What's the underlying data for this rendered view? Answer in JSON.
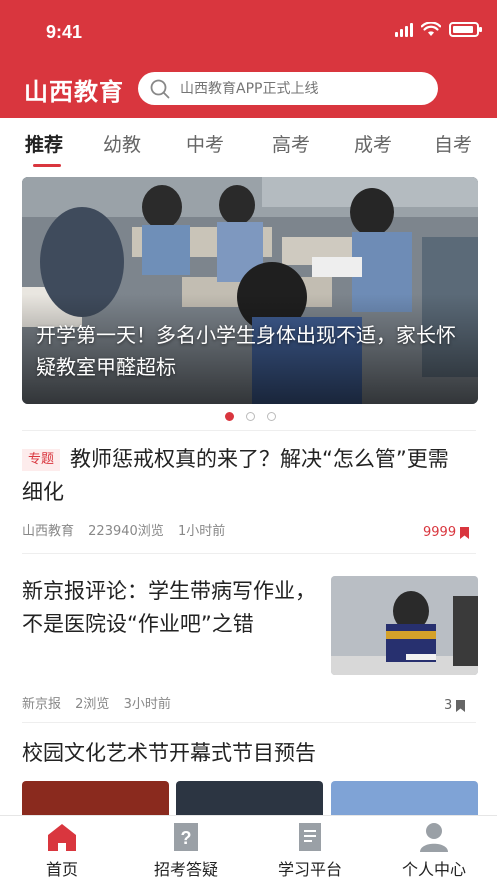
{
  "status_bar": {
    "time": "9:41"
  },
  "header": {
    "title": "山西教育",
    "search_placeholder": "山西教育APP正式上线"
  },
  "tabs": [
    "推荐",
    "幼教",
    "中考",
    "高考",
    "成考",
    "自考"
  ],
  "banner": {
    "caption": "开学第一天！多名小学生身体出现不适，家长怀疑教室甲醛超标",
    "slide_count": 3,
    "active_slide": 1
  },
  "news": [
    {
      "tag": "专题",
      "title": "教师惩戒权真的来了？解决“怎么管”更需细化",
      "source": "山西教育",
      "views": "223940浏览",
      "time": "1小时前",
      "count": "9999"
    },
    {
      "title": "新京报评论：学生带病写作业，不是医院设“作业吧”之错",
      "source": "新京报",
      "views": "2浏览",
      "time": "3小时前",
      "count": "3"
    },
    {
      "title": "校园文化艺术节开幕式节目预告"
    }
  ],
  "bottom_nav": [
    {
      "label": "首页",
      "icon": "home-icon"
    },
    {
      "label": "招考答疑",
      "icon": "question-icon"
    },
    {
      "label": "学习平台",
      "icon": "document-icon"
    },
    {
      "label": "个人中心",
      "icon": "user-icon"
    }
  ],
  "colors": {
    "brand": "#d9363e",
    "nav_icon": "#9aa0a6"
  }
}
